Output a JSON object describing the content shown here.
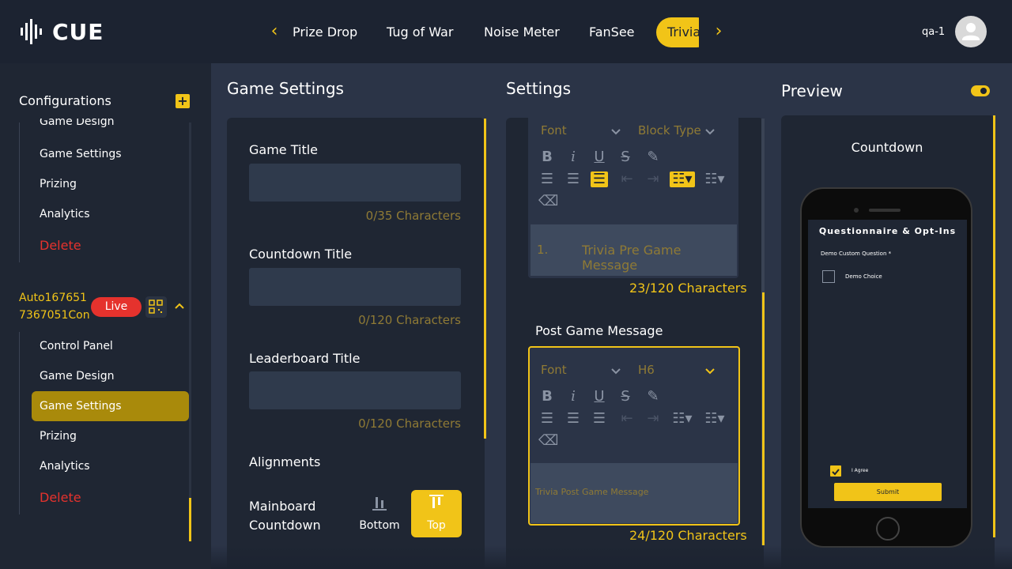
{
  "brand": {
    "name": "CUE"
  },
  "nav": {
    "tabs": [
      "Prize Drop",
      "Tug of War",
      "Noise Meter",
      "FanSee",
      "Trivia"
    ],
    "active_tab": "Trivia",
    "prev_icon": "chevron-left-icon",
    "next_icon": "chevron-right-icon"
  },
  "user": {
    "name": "qa-1"
  },
  "sidebar": {
    "header": "Configurations",
    "group1": [
      "Game Design",
      "Game Settings",
      "Prizing",
      "Analytics"
    ],
    "delete1": "Delete",
    "event": {
      "name_line1": "Auto167651",
      "name_line2": "7367051Con",
      "status": "Live"
    },
    "group2": [
      "Control Panel",
      "Game Design",
      "Game Settings",
      "Prizing",
      "Analytics"
    ],
    "delete2": "Delete",
    "selected": "Game Settings"
  },
  "game_settings": {
    "title": "Game Settings",
    "fields": [
      {
        "label": "Game Title",
        "value": "",
        "count": "0/35 Characters"
      },
      {
        "label": "Countdown Title",
        "value": "",
        "count": "0/120 Characters"
      },
      {
        "label": "Leaderboard Title",
        "value": "",
        "count": "0/120 Characters"
      }
    ],
    "alignments_label": "Alignments",
    "mainboard_countdown_label": "Mainboard Countdown",
    "align_options": [
      "Bottom",
      "Top"
    ],
    "align_selected": "Top"
  },
  "settings": {
    "title": "Settings",
    "pre_editor": {
      "font_label": "Font",
      "block_label": "Block Type",
      "list_prefix": "1.",
      "content": "Trivia Pre Game Message",
      "count": "23/120 Characters"
    },
    "post_label": "Post Game Message",
    "post_editor": {
      "font_label": "Font",
      "block_label": "H6",
      "content": "Trivia Post Game Message",
      "count": "24/120 Characters"
    },
    "toolbar_icons": [
      "bold-icon",
      "italic-icon",
      "underline-icon",
      "strikethrough-icon",
      "highlight-icon",
      "align-left-icon",
      "align-center-icon",
      "align-right-icon",
      "outdent-icon",
      "indent-icon",
      "ordered-list-icon",
      "unordered-list-icon",
      "clear-format-icon"
    ]
  },
  "preview": {
    "title": "Preview",
    "subtitle": "Countdown",
    "phone": {
      "heading": "Questionnaire & Opt-Ins",
      "question": "Demo Custom Question *",
      "choice": "Demo Choice",
      "agree": "I Agree",
      "submit": "Submit"
    }
  },
  "colors": {
    "accent": "#f1c418",
    "danger": "#e5322d",
    "bg": "#1f2633",
    "panel": "#2b3447"
  }
}
